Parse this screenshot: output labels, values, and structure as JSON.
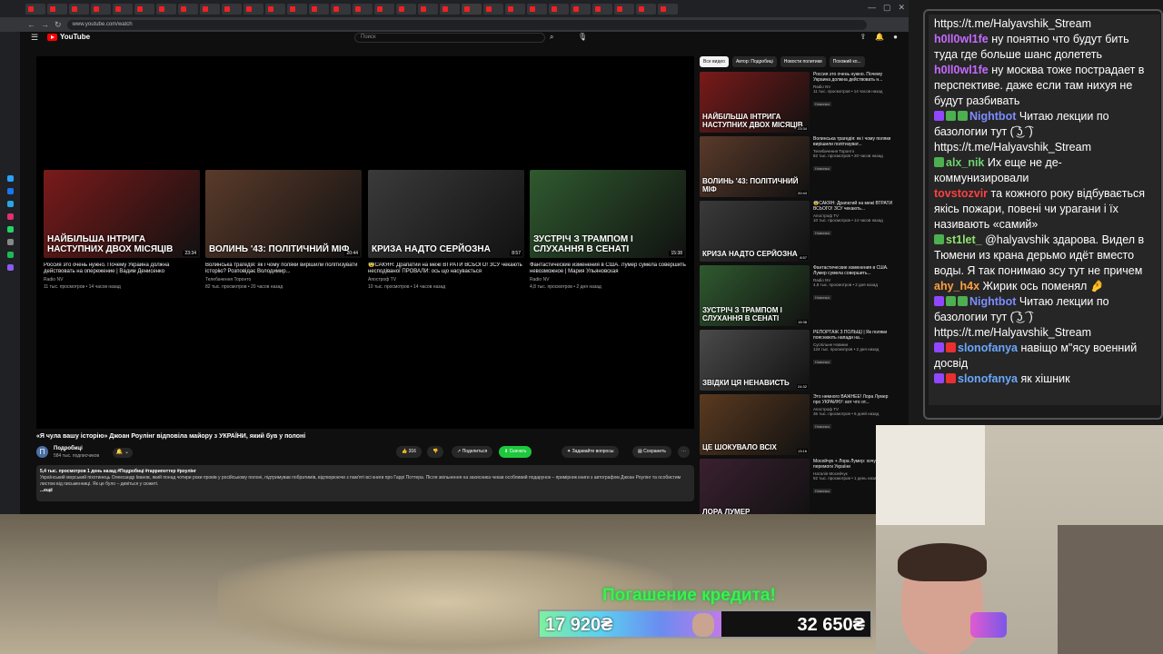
{
  "browser": {
    "tabs": [
      "",
      "",
      "",
      "",
      "",
      "",
      "",
      "",
      "",
      "",
      "",
      "",
      "",
      "",
      "",
      "",
      "",
      "",
      "",
      "",
      "",
      "",
      "",
      "",
      "",
      "",
      "",
      "",
      "",
      ""
    ],
    "url": "www.youtube.com/watch"
  },
  "youtube": {
    "logo": "YouTube",
    "search_placeholder": "Поиск"
  },
  "endcards": [
    {
      "caption": "НАЙБІЛЬША ІНТРИГА НАСТУПНИХ ДВОХ МІСЯЦІВ",
      "duration": "23:34",
      "title": "Россия это очень нужно. Почему Украина должна действовать на опережение | Вадим Денисенко",
      "channel": "Radio NV",
      "meta": "11 тыс. просмотров • 14 часов назад",
      "color": "#7a1a1a"
    },
    {
      "caption": "ВОЛИНЬ '43: ПОЛІТИЧНИЙ МІФ",
      "duration": "20:44",
      "title": "Волинська трагедія: як і чому поляки вирішили політизувати історію? Розповідає Володимир...",
      "channel": "Телебачення Торонто",
      "meta": "82 тыс. просмотров • 20 часов назад",
      "color": "#5a3a2a"
    },
    {
      "caption": "КРИЗА НАДТО СЕРЙОЗНА",
      "duration": "8:57",
      "title": "😨САКЯН: Драпатий на межі ВТРАТИ ВСЬОГО! ЗСУ чекають несподіваної ПРОВАЛИ: ось що насувається",
      "channel": "Апостроф TV",
      "meta": "10 тыс. просмотров • 14 часов назад",
      "color": "#3a3a3a"
    },
    {
      "caption": "ЗУСТРІЧ З ТРАМПОМ І СЛУХАННЯ В СЕНАТІ",
      "duration": "15:38",
      "title": "Фантастические изменения в США. Лумер сумела совершить невозможное | Мария Ульяновская",
      "channel": "Radio NV",
      "meta": "4,8 тыс. просмотров • 2 дня назад",
      "color": "#2f5a2f"
    }
  ],
  "video": {
    "title": "«Я чула вашу історію» Джоан Роулінг відповіла майору з УКРАЇНИ, який був у полоні",
    "channel": "Подробиці",
    "subs": "584 тыс. подписчиков",
    "likes": "316",
    "share": "Поделиться",
    "download": "Скачать",
    "ask": "Задавайте вопросы",
    "save": "Сохранить",
    "desc_meta": "5,4 тыс. просмотров  1 день назад  #Подробиці #гаррипоттер #роулінг",
    "desc_text": "Український морський піхотинець Олександр Іванов, який понад чотири роки провів у російському полоні, підтримував побратимів, відтворюючи з пам'яті всі книги про Гаррі Поттера. Після звільнення на захисника чекав особливий подарунок – примірник книги з автографом Джоан Роулінг та особистим листом від письменниці. Як це було – дивіться у сюжеті.",
    "more": "...ещё"
  },
  "sidebar": {
    "chips": [
      "Все видео",
      "Автор: Подробиці",
      "Новости политики",
      "Похожий ко..."
    ],
    "items": [
      {
        "caption": "НАЙБІЛЬША ІНТРИГА НАСТУПНИХ ДВОХ МІСЯЦІВ",
        "duration": "23:34",
        "title": "Россия это очень нужно. Почему Украина должна действовать н...",
        "channel": "Radio NV",
        "meta": "11 тыс. просмотров • 14 часов назад",
        "badge": "Новинка",
        "color": "#7a1a1a"
      },
      {
        "caption": "ВОЛИНЬ '43: ПОЛІТИЧНИЙ МІФ",
        "duration": "20:44",
        "title": "Волинська трагедія: як і чому поляки вирішили політизуват...",
        "channel": "Телебачення Торонто",
        "meta": "82 тыс. просмотров • 20 часов назад",
        "badge": "Новинка",
        "color": "#5a3a2a"
      },
      {
        "caption": "КРИЗА НАДТО СЕРЙОЗНА",
        "duration": "8:57",
        "title": "😨САКЯН: Драпатий на межі ВТРАТИ ВСЬОГО! ЗСУ чекають...",
        "channel": "Апостроф TV",
        "meta": "10 тыс. просмотров • 14 часов назад",
        "badge": "Новинка",
        "color": "#3a3a3a"
      },
      {
        "caption": "ЗУСТРІЧ З ТРАМПОМ І СЛУХАННЯ В СЕНАТІ",
        "duration": "15:38",
        "title": "Фантастические изменения в США. Лумер сумела совершить...",
        "channel": "Radio NV",
        "meta": "4,8 тыс. просмотров • 2 дня назад",
        "badge": "Новинка",
        "color": "#2f5a2f"
      },
      {
        "caption": "ЗВІДКИ ЦЯ НЕНАВИСТЬ",
        "duration": "24:32",
        "title": "РЕПОРТАЖ З ПОЛЬЩІ | Як поляки пояснюють напади на...",
        "channel": "Суспільне Новини",
        "meta": "124 тыс. просмотров • 2 дня назад",
        "badge": "Новинка",
        "color": "#4a4a4a"
      },
      {
        "caption": "ЦЕ ШОКУВАЛО ВСІХ",
        "duration": "13:16",
        "title": "Это немного ВАЖНЕЕ! Лора Лумер про УКРАИНУ: вот что от...",
        "channel": "Апостроф TV",
        "meta": "36 тыс. просмотров • 6 дней назад",
        "badge": "Новинка",
        "color": "#5a3a20"
      },
      {
        "caption": "ЛОРА ЛУМЕР",
        "duration": "",
        "title": "Мосейчук + Лора Лумер: хочуть перемоги України",
        "channel": "Наталія Мосейчук",
        "meta": "92 тыс. просмотров • 1 день назад",
        "badge": "Новинка",
        "color": "#3a2030"
      }
    ]
  },
  "chat": [
    {
      "user": "",
      "text": "https://t.me/Halyavshik_Stream",
      "color": "#ffffff",
      "icons": []
    },
    {
      "user": "h0ll0wl1fe",
      "text": " ну понятно что будут бить туда где больше шанс долететь",
      "color": "#c56bff",
      "icons": []
    },
    {
      "user": "h0ll0wl1fe",
      "text": " ну москва тоже пострадает в перспективе. даже если там нихуя не будут разбивать",
      "color": "#c56bff",
      "icons": []
    },
    {
      "user": "Nightbot",
      "text": " Читаю лекции по базологии тут (͡ ͜ʖ ͡ ) https://t.me/Halyavshik_Stream",
      "color": "#7c8dff",
      "icons": [
        "#9147ff",
        "#4caf50",
        "#4caf50"
      ]
    },
    {
      "user": "alx_nik",
      "text": " Их еще не де-коммунизировали",
      "color": "#6fd36f",
      "icons": [
        "#4caf50"
      ]
    },
    {
      "user": "tovstozvir",
      "text": " та кожного року відбувається якісь пожари, повені чи урагани і їх називають «самий»",
      "color": "#ff4040",
      "icons": []
    },
    {
      "user": "st1let_",
      "text": " @halyavshik здарова. Видел в Тюмени из крана дерьмо идёт вместо воды. Я так понимаю зсу тут не причем",
      "color": "#8fe36f",
      "icons": [
        "#4caf50"
      ]
    },
    {
      "user": "ahy_h4x",
      "text": " Жирик ось поменял 🤌",
      "color": "#ffa040",
      "icons": []
    },
    {
      "user": "Nightbot",
      "text": " Читаю лекции по базологии тут (͡ ͜ʖ ͡ ) https://t.me/Halyavshik_Stream",
      "color": "#7c8dff",
      "icons": [
        "#9147ff",
        "#4caf50",
        "#4caf50"
      ]
    },
    {
      "user": "slonofanya",
      "text": " навіщо м\"ясу военний досвід",
      "color": "#6aa8ff",
      "icons": [
        "#9147ff",
        "#e83030"
      ]
    },
    {
      "user": "slonofanya",
      "text": " як хішник",
      "color": "#6aa8ff",
      "icons": [
        "#9147ff",
        "#e83030"
      ]
    }
  ],
  "loan": {
    "title": "Погашение кредита!",
    "current": "17 920₴",
    "goal": "32 650₴",
    "progress_fraction": 0.549
  }
}
